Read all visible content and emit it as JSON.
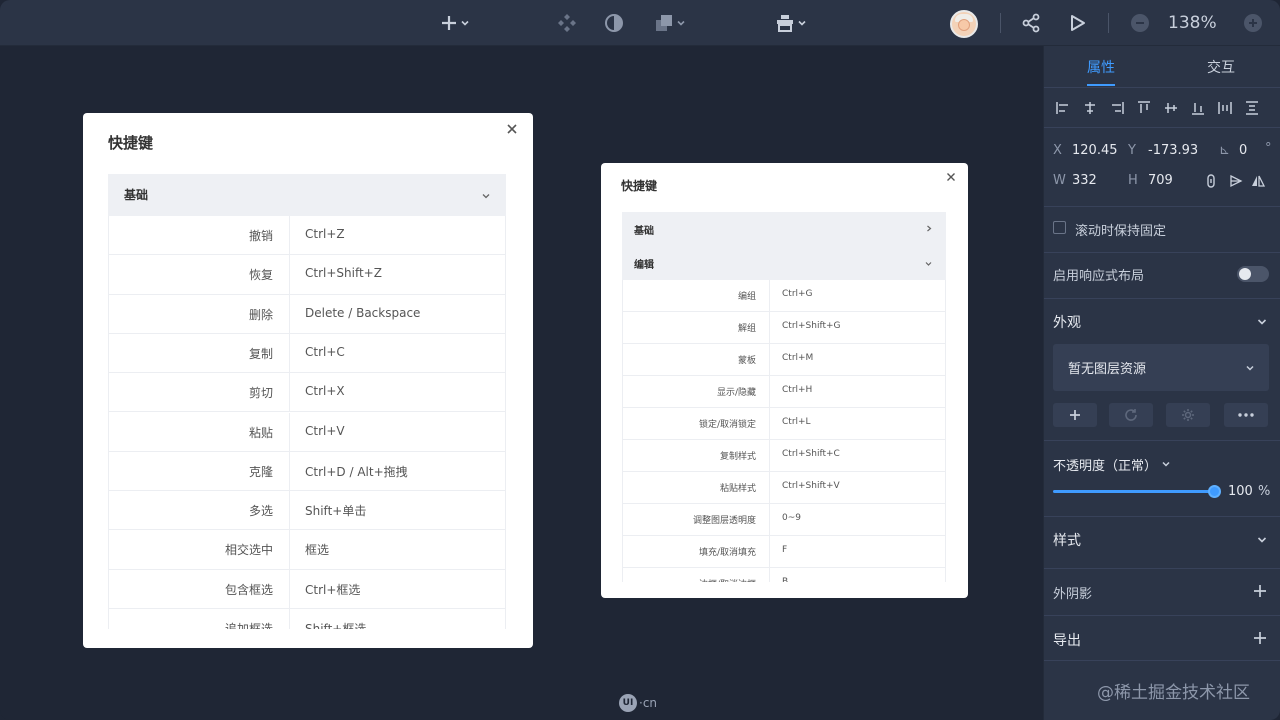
{
  "toolbar": {
    "zoom": "138%",
    "items": [
      "add-icon",
      "component-icon",
      "contrast-icon",
      "layers-icon",
      "container-icon",
      "share-icon",
      "play-icon",
      "zoom-out-icon",
      "zoom-in-icon"
    ]
  },
  "panel": {
    "tabs": [
      "属性",
      "交互"
    ],
    "x_label": "X",
    "x_value": "120.45",
    "y_label": "Y",
    "y_value": "-173.93",
    "angle_label": "⊾",
    "angle_value": "0",
    "angle_unit": "°",
    "w_label": "W",
    "w_value": "332",
    "h_label": "H",
    "h_value": "709",
    "fixed_on_scroll": "滚动时保持固定",
    "responsive_layout": "启用响应式布局",
    "appearance": "外观",
    "no_layer_resource": "暂无图层资源",
    "opacity_label": "不透明度（正常）",
    "opacity_value": "100",
    "opacity_unit": "%",
    "opacity_fraction": 1.0,
    "style": "样式",
    "shadow": "外阴影",
    "export": "导出"
  },
  "dialog_left": {
    "title": "快捷键",
    "group": "基础",
    "rows": [
      {
        "cmd": "撤销",
        "key": "Ctrl+Z"
      },
      {
        "cmd": "恢复",
        "key": "Ctrl+Shift+Z"
      },
      {
        "cmd": "删除",
        "key": "Delete / Backspace"
      },
      {
        "cmd": "复制",
        "key": "Ctrl+C"
      },
      {
        "cmd": "剪切",
        "key": "Ctrl+X"
      },
      {
        "cmd": "粘贴",
        "key": "Ctrl+V"
      },
      {
        "cmd": "克隆",
        "key": "Ctrl+D / Alt+拖拽"
      },
      {
        "cmd": "多选",
        "key": "Shift+单击"
      },
      {
        "cmd": "相交选中",
        "key": "框选"
      },
      {
        "cmd": "包含框选",
        "key": "Ctrl+框选"
      },
      {
        "cmd": "追加框选",
        "key": "Shift+框选"
      }
    ]
  },
  "dialog_right": {
    "title": "快捷键",
    "group_collapsed": "基础",
    "group_open": "编辑",
    "rows": [
      {
        "cmd": "编组",
        "key": "Ctrl+G"
      },
      {
        "cmd": "解组",
        "key": "Ctrl+Shift+G"
      },
      {
        "cmd": "蒙板",
        "key": "Ctrl+M"
      },
      {
        "cmd": "显示/隐藏",
        "key": "Ctrl+H"
      },
      {
        "cmd": "锁定/取消锁定",
        "key": "Ctrl+L"
      },
      {
        "cmd": "复制样式",
        "key": "Ctrl+Shift+C"
      },
      {
        "cmd": "粘贴样式",
        "key": "Ctrl+Shift+V"
      },
      {
        "cmd": "调整图层透明度",
        "key": "0~9"
      },
      {
        "cmd": "填充/取消填充",
        "key": "F"
      },
      {
        "cmd": "边框/取消边框",
        "key": "B"
      }
    ]
  },
  "footer": {
    "logo_mark": "UI",
    "logo_text": "·cn",
    "watermark": "@稀土掘金技术社区"
  }
}
